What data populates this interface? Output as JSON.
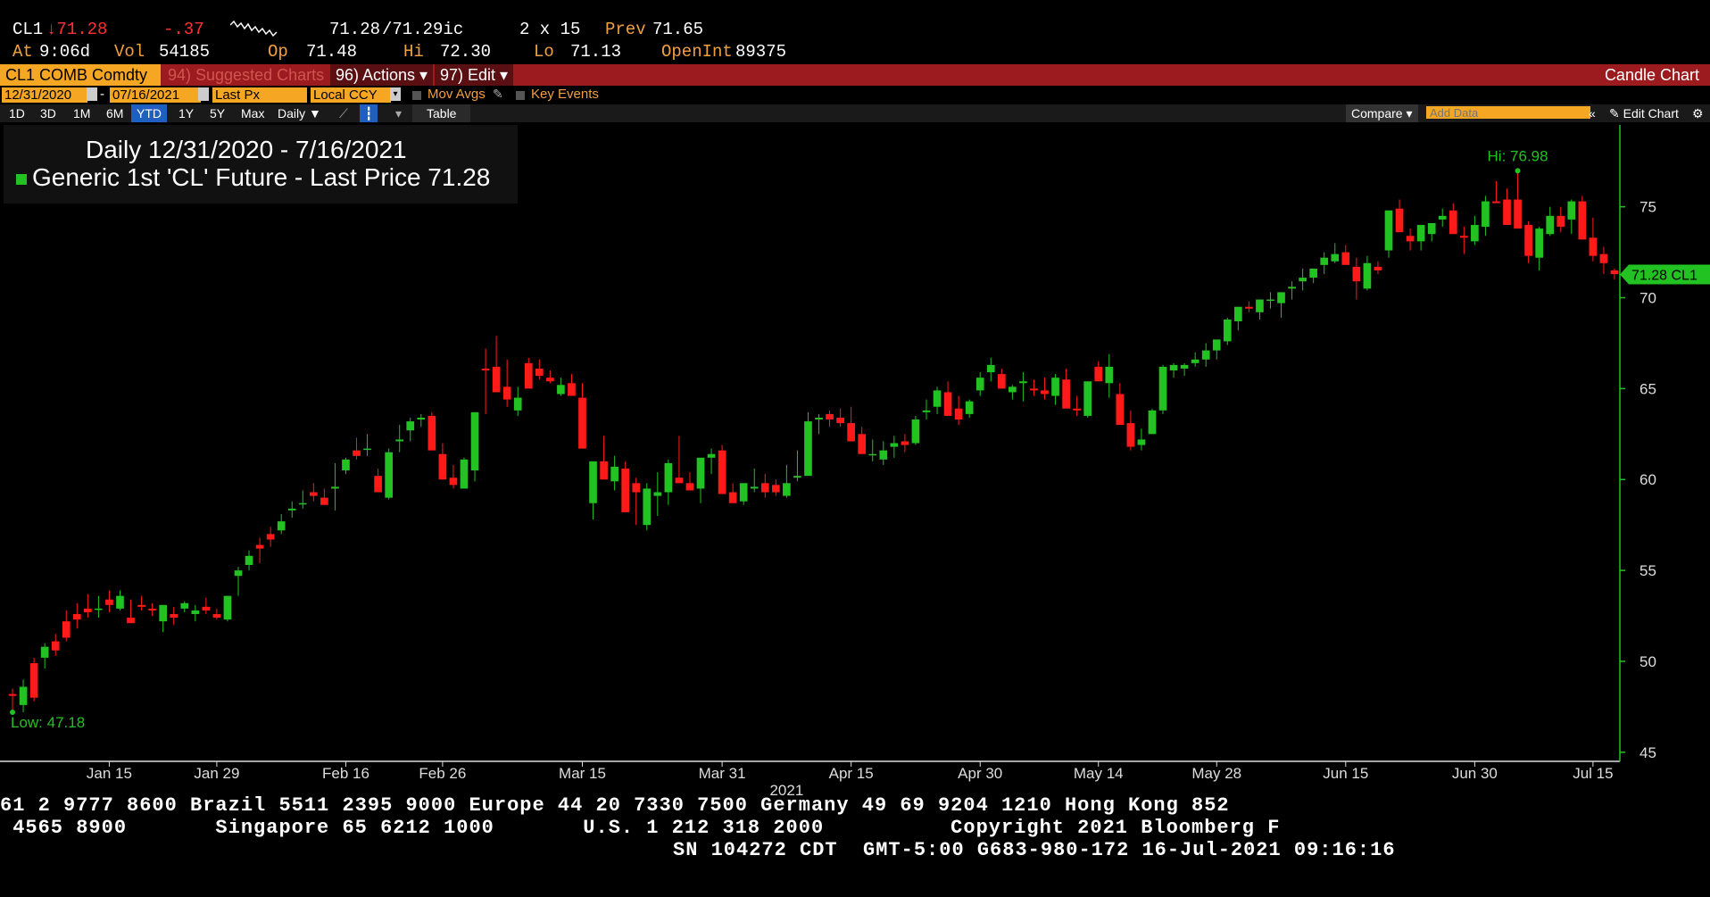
{
  "header": {
    "ticker": "CL1",
    "arrow": "↓",
    "last": "71.28",
    "change": "-.37",
    "bid_ask": "71.28",
    "ask": "/71.29",
    "ask_suffix": "ic",
    "size": "2 x 15",
    "prev_label": "Prev",
    "prev": "71.65",
    "at_label": "At",
    "at_time": "9:06d",
    "vol_label": "Vol",
    "vol": "54185",
    "op_label": "Op",
    "op": "71.48",
    "hi_label": "Hi",
    "hi": "72.30",
    "lo_label": "Lo",
    "lo": "71.13",
    "oi_label": "OpenInt",
    "oi": "89375"
  },
  "menubar": {
    "security": "CL1 COMB Comdty",
    "suggested": "94) Suggested Charts",
    "actions": "96) Actions ▾",
    "edit": "97) Edit ▾",
    "title": "Candle Chart"
  },
  "params": {
    "start_date": "12/31/2020",
    "end_date": "07/16/2021",
    "field": "Last Px",
    "currency": "Local CCY",
    "mov_avgs": "Mov Avgs",
    "key_events": "Key Events"
  },
  "toolbar": {
    "ranges": [
      "1D",
      "3D",
      "1M",
      "6M",
      "YTD",
      "1Y",
      "5Y",
      "Max"
    ],
    "selected": "YTD",
    "interval": "Daily ▼",
    "table": "Table",
    "compare": "Compare ▾",
    "add_data_placeholder": "Add Data",
    "edit_chart": "Edit Chart"
  },
  "legend": {
    "line1": "Daily 12/31/2020 - 7/16/2021",
    "line2": "Generic 1st 'CL' Future - Last Price 71.28"
  },
  "colors": {
    "up": "#21c221",
    "down": "#ff1a1a",
    "axis": "#21c221",
    "menubar": "#9b1b1e",
    "field_bg": "#f5a623"
  },
  "chart_data": {
    "type": "candlestick",
    "title": "Daily 12/31/2020 - 7/16/2021",
    "series_name": "Generic 1st 'CL' Future - Last Price",
    "last_price": 71.28,
    "last_label": "71.28 CL1",
    "high_label": "Hi: 76.98",
    "low_label": "Low: 47.18",
    "ylim": [
      44.5,
      79.5
    ],
    "yticks": [
      45,
      50,
      55,
      60,
      65,
      70,
      75
    ],
    "xticks": [
      "Jan 15",
      "Jan 29",
      "Feb 16",
      "Feb 26",
      "Mar 15",
      "Mar 31",
      "Apr 15",
      "Apr 30",
      "May 14",
      "May 28",
      "Jun 15",
      "Jun 30",
      "Jul 15"
    ],
    "xticks_index": [
      9,
      19,
      31,
      40,
      53,
      66,
      78,
      90,
      101,
      112,
      124,
      136,
      147
    ],
    "year_label": "2021",
    "year_index": 72,
    "candles": [
      [
        48.2,
        48.5,
        47.2,
        48.1
      ],
      [
        47.6,
        49.0,
        47.2,
        48.6
      ],
      [
        49.9,
        50.2,
        47.8,
        48.0
      ],
      [
        50.2,
        51.0,
        49.6,
        50.8
      ],
      [
        51.1,
        51.5,
        50.3,
        50.6
      ],
      [
        52.2,
        52.8,
        51.1,
        51.3
      ],
      [
        52.6,
        53.2,
        51.8,
        52.3
      ],
      [
        52.9,
        53.7,
        52.4,
        52.7
      ],
      [
        52.9,
        53.6,
        52.4,
        52.9
      ],
      [
        53.4,
        53.9,
        52.7,
        53.1
      ],
      [
        52.9,
        53.9,
        52.8,
        53.6
      ],
      [
        52.4,
        53.4,
        52.1,
        52.1
      ],
      [
        53.1,
        53.6,
        52.8,
        53.0
      ],
      [
        52.9,
        53.2,
        52.5,
        52.8
      ],
      [
        52.2,
        53.1,
        51.6,
        53.1
      ],
      [
        52.6,
        53.0,
        52.0,
        52.4
      ],
      [
        52.9,
        53.3,
        52.7,
        53.2
      ],
      [
        52.6,
        53.1,
        52.2,
        52.8
      ],
      [
        53.0,
        53.5,
        52.6,
        52.8
      ],
      [
        52.6,
        52.9,
        52.3,
        52.4
      ],
      [
        52.3,
        53.6,
        52.2,
        53.6
      ],
      [
        54.7,
        55.2,
        53.6,
        55.0
      ],
      [
        55.3,
        56.1,
        55.0,
        55.8
      ],
      [
        56.4,
        56.8,
        55.4,
        56.2
      ],
      [
        57.0,
        57.4,
        56.3,
        56.7
      ],
      [
        57.2,
        58.1,
        57.0,
        57.7
      ],
      [
        58.3,
        58.8,
        57.9,
        58.4
      ],
      [
        58.7,
        59.4,
        58.4,
        58.7
      ],
      [
        59.3,
        59.8,
        58.8,
        59.1
      ],
      [
        59.0,
        59.5,
        58.7,
        58.6
      ],
      [
        59.5,
        60.9,
        58.3,
        59.6
      ],
      [
        60.5,
        61.2,
        60.3,
        61.1
      ],
      [
        61.6,
        62.3,
        61.1,
        61.3
      ],
      [
        61.7,
        62.5,
        61.3,
        61.7
      ],
      [
        60.2,
        60.6,
        59.3,
        59.3
      ],
      [
        59.0,
        61.7,
        58.9,
        61.5
      ],
      [
        62.1,
        63.0,
        61.5,
        62.2
      ],
      [
        62.7,
        63.4,
        62.1,
        63.2
      ],
      [
        63.3,
        63.6,
        62.9,
        63.4
      ],
      [
        63.5,
        63.7,
        62.2,
        61.6
      ],
      [
        61.4,
        62.0,
        60.4,
        60.0
      ],
      [
        60.1,
        60.8,
        59.5,
        59.7
      ],
      [
        59.5,
        61.2,
        59.6,
        61.1
      ],
      [
        60.5,
        63.4,
        59.9,
        63.7
      ],
      [
        66.1,
        67.2,
        63.6,
        66.0
      ],
      [
        66.2,
        67.9,
        64.9,
        64.8
      ],
      [
        65.1,
        66.6,
        64.0,
        64.4
      ],
      [
        63.8,
        65.1,
        63.5,
        64.5
      ],
      [
        66.4,
        66.7,
        65.5,
        65.0
      ],
      [
        66.1,
        66.6,
        65.5,
        65.7
      ],
      [
        65.6,
        66.0,
        65.3,
        65.4
      ],
      [
        64.7,
        65.6,
        64.6,
        65.2
      ],
      [
        65.3,
        65.8,
        64.9,
        64.6
      ],
      [
        64.5,
        65.3,
        63.5,
        61.7
      ],
      [
        58.7,
        60.2,
        57.8,
        61.0
      ],
      [
        61.0,
        62.4,
        60.1,
        60.0
      ],
      [
        59.9,
        61.3,
        59.4,
        60.7
      ],
      [
        60.6,
        61.0,
        60.1,
        58.2
      ],
      [
        59.8,
        60.1,
        57.5,
        59.3
      ],
      [
        57.5,
        59.8,
        57.2,
        59.5
      ],
      [
        59.1,
        60.4,
        58.0,
        59.3
      ],
      [
        59.3,
        61.1,
        58.6,
        60.9
      ],
      [
        60.1,
        62.4,
        60.0,
        59.8
      ],
      [
        59.8,
        60.4,
        59.5,
        59.4
      ],
      [
        59.5,
        60.6,
        58.7,
        61.2
      ],
      [
        61.2,
        61.7,
        60.3,
        61.4
      ],
      [
        61.6,
        61.9,
        60.5,
        59.2
      ],
      [
        59.3,
        59.8,
        58.8,
        58.7
      ],
      [
        58.8,
        59.5,
        58.6,
        59.8
      ],
      [
        59.5,
        60.6,
        59.3,
        59.6
      ],
      [
        59.8,
        60.3,
        59.0,
        59.3
      ],
      [
        59.7,
        60.0,
        59.1,
        59.3
      ],
      [
        59.1,
        60.8,
        59.0,
        59.8
      ],
      [
        60.1,
        61.6,
        59.9,
        60.2
      ],
      [
        60.2,
        63.7,
        60.5,
        63.2
      ],
      [
        63.3,
        63.6,
        62.5,
        63.4
      ],
      [
        63.6,
        63.8,
        62.9,
        63.3
      ],
      [
        63.4,
        63.9,
        62.9,
        63.1
      ],
      [
        63.1,
        64.0,
        62.4,
        62.1
      ],
      [
        62.5,
        62.9,
        61.6,
        61.4
      ],
      [
        61.4,
        62.2,
        61.0,
        61.4
      ],
      [
        61.1,
        62.1,
        60.8,
        61.6
      ],
      [
        61.8,
        62.4,
        61.2,
        62.0
      ],
      [
        62.1,
        62.5,
        61.5,
        61.9
      ],
      [
        62.0,
        63.5,
        61.9,
        63.3
      ],
      [
        63.7,
        64.4,
        63.3,
        63.8
      ],
      [
        64.0,
        65.1,
        63.6,
        64.9
      ],
      [
        64.8,
        65.4,
        64.0,
        63.5
      ],
      [
        63.9,
        64.6,
        63.0,
        63.3
      ],
      [
        63.6,
        64.4,
        63.4,
        64.3
      ],
      [
        64.9,
        65.9,
        64.6,
        65.6
      ],
      [
        65.9,
        66.7,
        65.4,
        66.3
      ],
      [
        65.8,
        66.1,
        65.0,
        65.0
      ],
      [
        64.8,
        65.2,
        64.4,
        65.1
      ],
      [
        65.3,
        65.9,
        64.3,
        65.4
      ],
      [
        65.0,
        65.5,
        64.6,
        64.9
      ],
      [
        64.9,
        65.6,
        64.4,
        64.7
      ],
      [
        64.6,
        65.8,
        64.1,
        65.6
      ],
      [
        65.5,
        66.1,
        64.9,
        63.9
      ],
      [
        63.9,
        64.6,
        63.5,
        63.8
      ],
      [
        63.5,
        64.9,
        63.4,
        65.4
      ],
      [
        66.2,
        66.5,
        65.4,
        65.4
      ],
      [
        65.3,
        66.9,
        64.5,
        66.2
      ],
      [
        64.7,
        65.3,
        63.9,
        63.0
      ],
      [
        63.1,
        63.8,
        61.6,
        61.8
      ],
      [
        61.9,
        62.8,
        61.6,
        62.2
      ],
      [
        62.5,
        63.9,
        62.5,
        63.8
      ],
      [
        63.8,
        66.3,
        63.6,
        66.2
      ],
      [
        66.0,
        66.4,
        65.6,
        66.3
      ],
      [
        66.1,
        66.4,
        65.7,
        66.3
      ],
      [
        66.4,
        67.0,
        66.2,
        66.6
      ],
      [
        66.6,
        67.5,
        66.2,
        67.1
      ],
      [
        67.1,
        67.6,
        66.6,
        67.7
      ],
      [
        67.6,
        68.9,
        67.4,
        68.8
      ],
      [
        68.7,
        69.0,
        68.2,
        69.5
      ],
      [
        69.5,
        69.8,
        69.2,
        69.4
      ],
      [
        69.2,
        69.9,
        68.8,
        69.9
      ],
      [
        69.9,
        70.3,
        69.4,
        69.9
      ],
      [
        69.7,
        70.3,
        68.9,
        70.3
      ],
      [
        70.5,
        70.9,
        69.9,
        70.6
      ],
      [
        70.9,
        71.6,
        70.4,
        71.1
      ],
      [
        71.1,
        71.6,
        70.8,
        71.6
      ],
      [
        71.8,
        72.5,
        71.3,
        72.2
      ],
      [
        72.0,
        73.0,
        71.9,
        72.4
      ],
      [
        72.5,
        72.9,
        71.9,
        71.8
      ],
      [
        71.7,
        72.2,
        69.9,
        70.9
      ],
      [
        70.5,
        72.3,
        70.4,
        71.9
      ],
      [
        71.7,
        72.0,
        71.3,
        71.5
      ],
      [
        72.6,
        73.9,
        72.2,
        74.8
      ],
      [
        74.9,
        75.4,
        74.2,
        73.6
      ],
      [
        73.4,
        73.8,
        72.6,
        73.1
      ],
      [
        73.1,
        73.6,
        72.6,
        74.0
      ],
      [
        73.5,
        73.8,
        73.1,
        74.1
      ],
      [
        74.3,
        74.9,
        73.9,
        74.5
      ],
      [
        74.8,
        75.2,
        74.3,
        73.5
      ],
      [
        73.4,
        73.9,
        72.4,
        73.3
      ],
      [
        73.1,
        74.5,
        72.9,
        74.0
      ],
      [
        73.9,
        75.6,
        73.4,
        75.3
      ],
      [
        75.3,
        76.4,
        75.2,
        75.2
      ],
      [
        75.4,
        76.0,
        74.8,
        74.0
      ],
      [
        75.4,
        76.98,
        74.8,
        73.8
      ],
      [
        74.0,
        74.2,
        71.9,
        72.3
      ],
      [
        72.2,
        73.9,
        71.5,
        73.8
      ],
      [
        73.5,
        75.0,
        73.4,
        74.5
      ],
      [
        74.5,
        75.0,
        73.6,
        73.9
      ],
      [
        74.3,
        75.4,
        73.5,
        75.3
      ],
      [
        75.3,
        75.6,
        74.5,
        73.2
      ],
      [
        73.3,
        74.4,
        72.0,
        72.3
      ],
      [
        72.4,
        72.8,
        71.3,
        71.9
      ],
      [
        71.5,
        71.6,
        71.0,
        71.3
      ]
    ]
  },
  "footer": {
    "line1": "61 2 9777 8600 Brazil 5511 2395 9000 Europe 44 20 7330 7500 Germany 49 69 9204 1210 Hong Kong 852",
    "line2": " 4565 8900       Singapore 65 6212 1000       U.S. 1 212 318 2000          Copyright 2021 Bloomberg F",
    "line3": "SN 104272 CDT  GMT-5:00 G683-980-172 16-Jul-2021 09:16:16"
  }
}
